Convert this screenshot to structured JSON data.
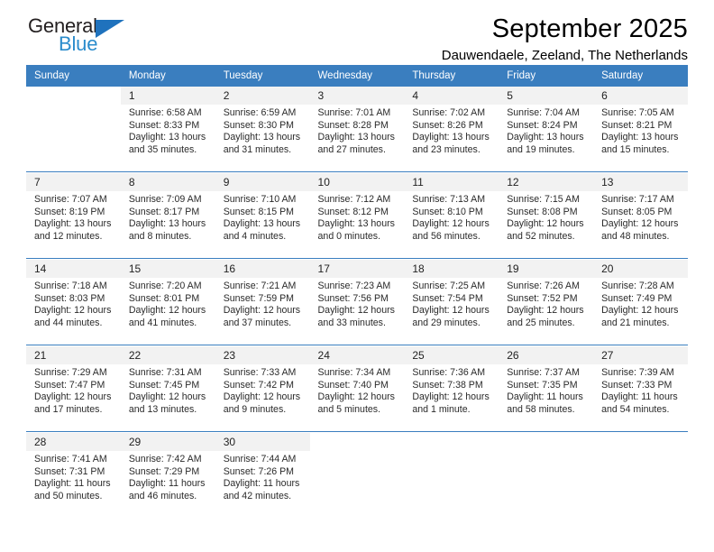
{
  "brand": {
    "name_part1": "General",
    "name_part2": "Blue",
    "triangle_color": "#1f72bd",
    "blue_text_color": "#2b8ccc"
  },
  "header": {
    "title": "September 2025",
    "subtitle": "Dauwendaele, Zeeland, The Netherlands"
  },
  "theme": {
    "header_bg": "#3a7ebf",
    "daynum_bg": "#f2f2f2",
    "separator": "#3a7ebf"
  },
  "weekday_headers": [
    "Sunday",
    "Monday",
    "Tuesday",
    "Wednesday",
    "Thursday",
    "Friday",
    "Saturday"
  ],
  "weeks": [
    {
      "days": [
        {
          "num": "",
          "sunrise": "",
          "sunset": "",
          "daylight1": "",
          "daylight2": ""
        },
        {
          "num": "1",
          "sunrise": "Sunrise: 6:58 AM",
          "sunset": "Sunset: 8:33 PM",
          "daylight1": "Daylight: 13 hours",
          "daylight2": "and 35 minutes."
        },
        {
          "num": "2",
          "sunrise": "Sunrise: 6:59 AM",
          "sunset": "Sunset: 8:30 PM",
          "daylight1": "Daylight: 13 hours",
          "daylight2": "and 31 minutes."
        },
        {
          "num": "3",
          "sunrise": "Sunrise: 7:01 AM",
          "sunset": "Sunset: 8:28 PM",
          "daylight1": "Daylight: 13 hours",
          "daylight2": "and 27 minutes."
        },
        {
          "num": "4",
          "sunrise": "Sunrise: 7:02 AM",
          "sunset": "Sunset: 8:26 PM",
          "daylight1": "Daylight: 13 hours",
          "daylight2": "and 23 minutes."
        },
        {
          "num": "5",
          "sunrise": "Sunrise: 7:04 AM",
          "sunset": "Sunset: 8:24 PM",
          "daylight1": "Daylight: 13 hours",
          "daylight2": "and 19 minutes."
        },
        {
          "num": "6",
          "sunrise": "Sunrise: 7:05 AM",
          "sunset": "Sunset: 8:21 PM",
          "daylight1": "Daylight: 13 hours",
          "daylight2": "and 15 minutes."
        }
      ]
    },
    {
      "days": [
        {
          "num": "7",
          "sunrise": "Sunrise: 7:07 AM",
          "sunset": "Sunset: 8:19 PM",
          "daylight1": "Daylight: 13 hours",
          "daylight2": "and 12 minutes."
        },
        {
          "num": "8",
          "sunrise": "Sunrise: 7:09 AM",
          "sunset": "Sunset: 8:17 PM",
          "daylight1": "Daylight: 13 hours",
          "daylight2": "and 8 minutes."
        },
        {
          "num": "9",
          "sunrise": "Sunrise: 7:10 AM",
          "sunset": "Sunset: 8:15 PM",
          "daylight1": "Daylight: 13 hours",
          "daylight2": "and 4 minutes."
        },
        {
          "num": "10",
          "sunrise": "Sunrise: 7:12 AM",
          "sunset": "Sunset: 8:12 PM",
          "daylight1": "Daylight: 13 hours",
          "daylight2": "and 0 minutes."
        },
        {
          "num": "11",
          "sunrise": "Sunrise: 7:13 AM",
          "sunset": "Sunset: 8:10 PM",
          "daylight1": "Daylight: 12 hours",
          "daylight2": "and 56 minutes."
        },
        {
          "num": "12",
          "sunrise": "Sunrise: 7:15 AM",
          "sunset": "Sunset: 8:08 PM",
          "daylight1": "Daylight: 12 hours",
          "daylight2": "and 52 minutes."
        },
        {
          "num": "13",
          "sunrise": "Sunrise: 7:17 AM",
          "sunset": "Sunset: 8:05 PM",
          "daylight1": "Daylight: 12 hours",
          "daylight2": "and 48 minutes."
        }
      ]
    },
    {
      "days": [
        {
          "num": "14",
          "sunrise": "Sunrise: 7:18 AM",
          "sunset": "Sunset: 8:03 PM",
          "daylight1": "Daylight: 12 hours",
          "daylight2": "and 44 minutes."
        },
        {
          "num": "15",
          "sunrise": "Sunrise: 7:20 AM",
          "sunset": "Sunset: 8:01 PM",
          "daylight1": "Daylight: 12 hours",
          "daylight2": "and 41 minutes."
        },
        {
          "num": "16",
          "sunrise": "Sunrise: 7:21 AM",
          "sunset": "Sunset: 7:59 PM",
          "daylight1": "Daylight: 12 hours",
          "daylight2": "and 37 minutes."
        },
        {
          "num": "17",
          "sunrise": "Sunrise: 7:23 AM",
          "sunset": "Sunset: 7:56 PM",
          "daylight1": "Daylight: 12 hours",
          "daylight2": "and 33 minutes."
        },
        {
          "num": "18",
          "sunrise": "Sunrise: 7:25 AM",
          "sunset": "Sunset: 7:54 PM",
          "daylight1": "Daylight: 12 hours",
          "daylight2": "and 29 minutes."
        },
        {
          "num": "19",
          "sunrise": "Sunrise: 7:26 AM",
          "sunset": "Sunset: 7:52 PM",
          "daylight1": "Daylight: 12 hours",
          "daylight2": "and 25 minutes."
        },
        {
          "num": "20",
          "sunrise": "Sunrise: 7:28 AM",
          "sunset": "Sunset: 7:49 PM",
          "daylight1": "Daylight: 12 hours",
          "daylight2": "and 21 minutes."
        }
      ]
    },
    {
      "days": [
        {
          "num": "21",
          "sunrise": "Sunrise: 7:29 AM",
          "sunset": "Sunset: 7:47 PM",
          "daylight1": "Daylight: 12 hours",
          "daylight2": "and 17 minutes."
        },
        {
          "num": "22",
          "sunrise": "Sunrise: 7:31 AM",
          "sunset": "Sunset: 7:45 PM",
          "daylight1": "Daylight: 12 hours",
          "daylight2": "and 13 minutes."
        },
        {
          "num": "23",
          "sunrise": "Sunrise: 7:33 AM",
          "sunset": "Sunset: 7:42 PM",
          "daylight1": "Daylight: 12 hours",
          "daylight2": "and 9 minutes."
        },
        {
          "num": "24",
          "sunrise": "Sunrise: 7:34 AM",
          "sunset": "Sunset: 7:40 PM",
          "daylight1": "Daylight: 12 hours",
          "daylight2": "and 5 minutes."
        },
        {
          "num": "25",
          "sunrise": "Sunrise: 7:36 AM",
          "sunset": "Sunset: 7:38 PM",
          "daylight1": "Daylight: 12 hours",
          "daylight2": "and 1 minute."
        },
        {
          "num": "26",
          "sunrise": "Sunrise: 7:37 AM",
          "sunset": "Sunset: 7:35 PM",
          "daylight1": "Daylight: 11 hours",
          "daylight2": "and 58 minutes."
        },
        {
          "num": "27",
          "sunrise": "Sunrise: 7:39 AM",
          "sunset": "Sunset: 7:33 PM",
          "daylight1": "Daylight: 11 hours",
          "daylight2": "and 54 minutes."
        }
      ]
    },
    {
      "days": [
        {
          "num": "28",
          "sunrise": "Sunrise: 7:41 AM",
          "sunset": "Sunset: 7:31 PM",
          "daylight1": "Daylight: 11 hours",
          "daylight2": "and 50 minutes."
        },
        {
          "num": "29",
          "sunrise": "Sunrise: 7:42 AM",
          "sunset": "Sunset: 7:29 PM",
          "daylight1": "Daylight: 11 hours",
          "daylight2": "and 46 minutes."
        },
        {
          "num": "30",
          "sunrise": "Sunrise: 7:44 AM",
          "sunset": "Sunset: 7:26 PM",
          "daylight1": "Daylight: 11 hours",
          "daylight2": "and 42 minutes."
        },
        {
          "num": "",
          "sunrise": "",
          "sunset": "",
          "daylight1": "",
          "daylight2": ""
        },
        {
          "num": "",
          "sunrise": "",
          "sunset": "",
          "daylight1": "",
          "daylight2": ""
        },
        {
          "num": "",
          "sunrise": "",
          "sunset": "",
          "daylight1": "",
          "daylight2": ""
        },
        {
          "num": "",
          "sunrise": "",
          "sunset": "",
          "daylight1": "",
          "daylight2": ""
        }
      ]
    }
  ]
}
